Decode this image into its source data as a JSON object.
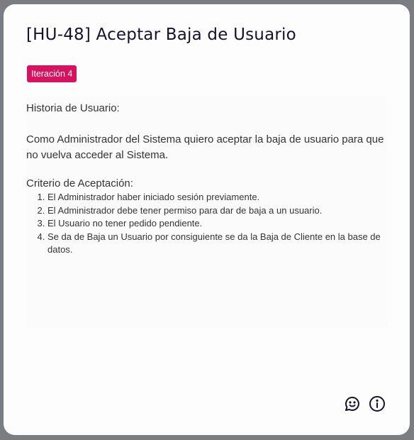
{
  "card": {
    "title": "[HU-48] Aceptar Baja de Usuario",
    "badge": "Iteración 4",
    "story_heading": "Historia de Usuario:",
    "story_text": "Como Administrador del Sistema quiero aceptar la baja de usuario para que no vuelva acceder al Sistema.",
    "criteria_heading": "Criterio de Aceptación:",
    "criteria": [
      "El Administrador haber iniciado sesión previamente.",
      "El Administrador debe tener permiso para dar de baja a un usuario.",
      "El Usuario no tener pedido pendiente.",
      "Se da de Baja un Usuario por consiguiente se da la Baja de Cliente en la base de datos."
    ]
  },
  "colors": {
    "badge": "#d8125f",
    "title": "#15122e",
    "background": "#7b7d83"
  },
  "icons": [
    "chat-smile-icon",
    "info-icon"
  ]
}
